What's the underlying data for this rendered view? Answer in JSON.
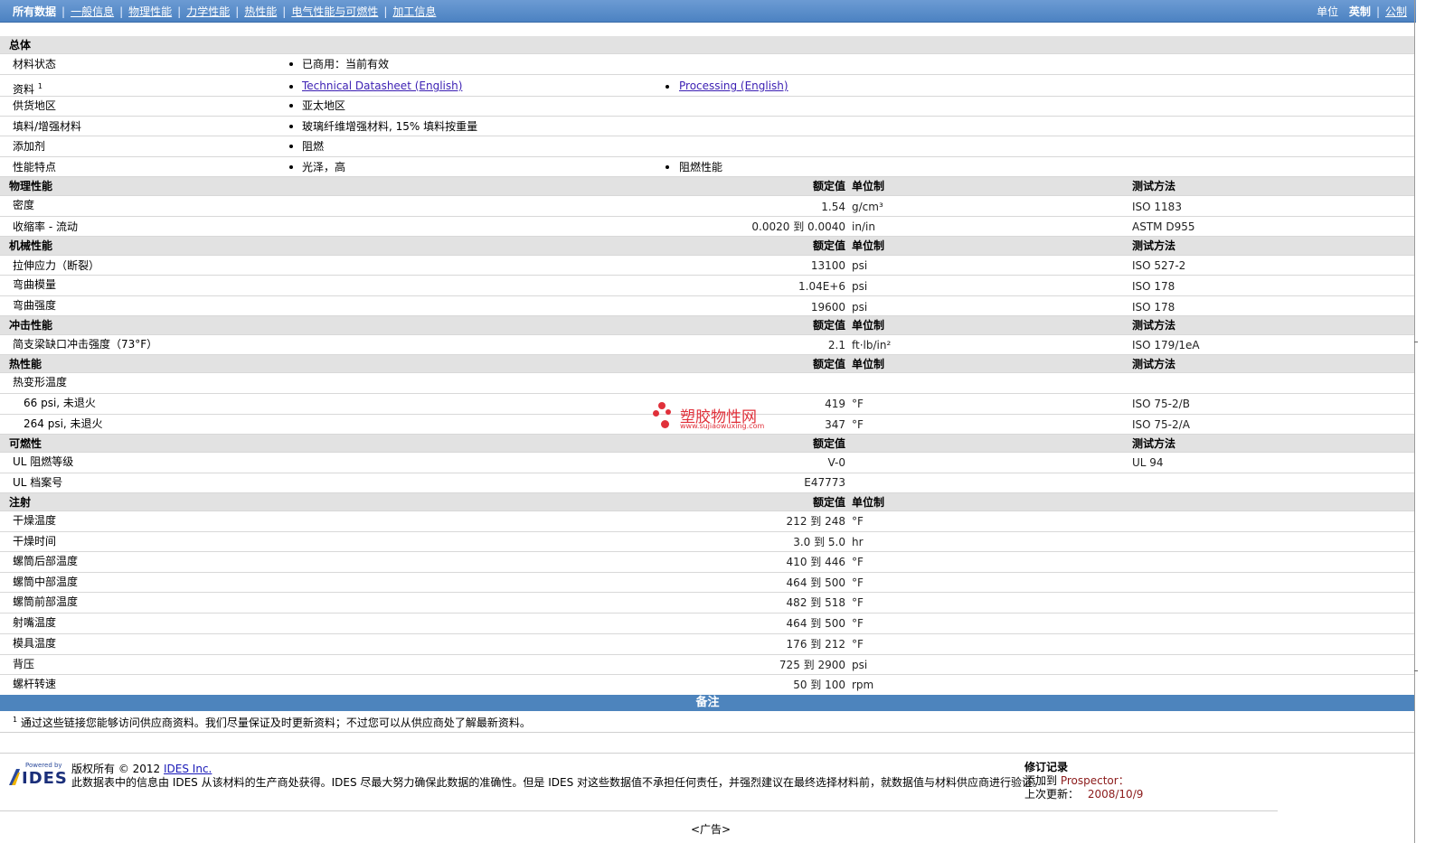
{
  "nav": {
    "items": [
      "所有数据",
      "一般信息",
      "物理性能",
      "力学性能",
      "热性能",
      "电气性能与可燃性",
      "加工信息"
    ],
    "units_label": "单位",
    "unit_english": "英制",
    "unit_metric": "公制"
  },
  "general": {
    "title": "总体",
    "rows": [
      {
        "label": "材料状态",
        "col1": "已商用：当前有效",
        "col2": ""
      },
      {
        "label": "资料",
        "sup": "1",
        "col1": "Technical Datasheet (English)",
        "col2": "Processing (English)"
      },
      {
        "label": "供货地区",
        "col1": "亚太地区",
        "col2": ""
      },
      {
        "label": "填料/增强材料",
        "col1": "玻璃纤维增强材料, 15% 填料按重量",
        "col2": ""
      },
      {
        "label": "添加剂",
        "col1": "阻燃",
        "col2": ""
      },
      {
        "label": "性能特点",
        "col1": "光泽，高",
        "col2": "阻燃性能"
      }
    ]
  },
  "headers": {
    "nominal": "额定值",
    "unit": "单位制",
    "test": "测试方法"
  },
  "physical": {
    "title": "物理性能",
    "rows": [
      {
        "label": "密度",
        "value": "1.54",
        "unit": "g/cm³",
        "test": "ISO 1183"
      },
      {
        "label": "收缩率 - 流动",
        "value": "0.0020 到  0.0040",
        "unit": "in/in",
        "test": "ASTM D955"
      }
    ]
  },
  "mechanical": {
    "title": "机械性能",
    "rows": [
      {
        "label": "拉伸应力（断裂）",
        "value": "13100",
        "unit": "psi",
        "test": "ISO 527-2"
      },
      {
        "label": "弯曲模量",
        "value": "1.04E+6",
        "unit": "psi",
        "test": "ISO 178"
      },
      {
        "label": "弯曲强度",
        "value": "19600",
        "unit": "psi",
        "test": "ISO 178"
      }
    ]
  },
  "impact": {
    "title": "冲击性能",
    "rows": [
      {
        "label": "简支梁缺口冲击强度（73°F）",
        "value": "2.1",
        "unit": "ft·lb/in²",
        "test": "ISO 179/1eA"
      }
    ]
  },
  "thermal": {
    "title": "热性能",
    "group": "热变形温度",
    "rows": [
      {
        "label": "66 psi, 未退火",
        "value": "419",
        "unit": "°F",
        "test": "ISO 75-2/B"
      },
      {
        "label": "264 psi, 未退火",
        "value": "347",
        "unit": "°F",
        "test": "ISO 75-2/A"
      }
    ]
  },
  "flammability": {
    "title": "可燃性",
    "rows": [
      {
        "label": "UL 阻燃等级",
        "value": "V-0",
        "unit": "",
        "test": "UL 94"
      },
      {
        "label": "UL 档案号",
        "value": "E47773",
        "unit": "",
        "test": ""
      }
    ]
  },
  "injection": {
    "title": "注射",
    "rows": [
      {
        "label": "干燥温度",
        "value": "212 到  248",
        "unit": "°F"
      },
      {
        "label": "干燥时间",
        "value": "3.0 到  5.0",
        "unit": "hr"
      },
      {
        "label": "螺筒后部温度",
        "value": "410 到  446",
        "unit": "°F"
      },
      {
        "label": "螺筒中部温度",
        "value": "464 到  500",
        "unit": "°F"
      },
      {
        "label": "螺筒前部温度",
        "value": "482 到  518",
        "unit": "°F"
      },
      {
        "label": "射嘴温度",
        "value": "464 到  500",
        "unit": "°F"
      },
      {
        "label": "模具温度",
        "value": "176 到  212",
        "unit": "°F"
      },
      {
        "label": "背压",
        "value": "725 到  2900",
        "unit": "psi"
      },
      {
        "label": "螺杆转速",
        "value": "50 到  100",
        "unit": "rpm"
      }
    ]
  },
  "notes": {
    "title": "备注",
    "footnote_num": "1",
    "footnote": "通过这些链接您能够访问供应商资料。我们尽量保证及时更新资料；不过您可以从供应商处了解最新资料。"
  },
  "footer": {
    "logo_powered": "Powered by",
    "logo_text": "IDES",
    "copyright_prefix": "版权所有 © 2012",
    "company": "IDES Inc.",
    "disclaimer": "此数据表中的信息由 IDES 从该材料的生产商处获得。IDES 尽最大努力确保此数据的准确性。但是 IDES 对这些数据值不承担任何责任，并强烈建议在最终选择材料前，就数据值与材料供应商进行验证。",
    "rev_title": "修订记录",
    "added_label": "添加到",
    "added_value": "Prospector：",
    "updated_label": "上次更新：",
    "updated_value": "2008/10/9",
    "ad": "<广告>"
  },
  "watermark": {
    "text": "塑胶物性网",
    "sub": "www.sujiaowuxing.com"
  },
  "colors": {
    "nav": "#4c82c2",
    "section": "#e2e2e2",
    "link": "#3b1fb3",
    "notes_bar": "#4d84bd"
  }
}
